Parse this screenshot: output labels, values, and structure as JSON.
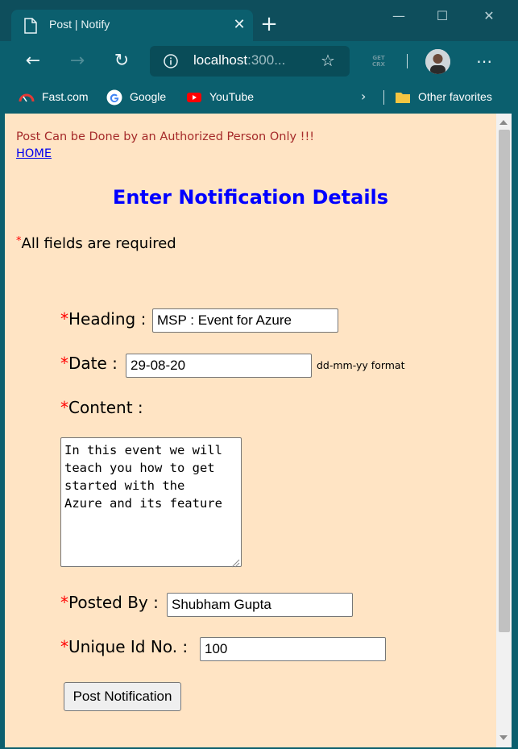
{
  "browser": {
    "tab_title": "Post | Notify",
    "url_host": "localhost",
    "url_rest": ":300...",
    "crx_label": "GET CRX",
    "favorites": [
      {
        "label": "Fast.com",
        "icon": "gauge-icon"
      },
      {
        "label": "Google",
        "icon": "google-icon"
      },
      {
        "label": "YouTube",
        "icon": "youtube-icon"
      }
    ],
    "other_favorites": "Other favorites"
  },
  "page": {
    "notice": "Post Can be Done by an Authorized Person Only !!!",
    "home_link": "HOME",
    "title": "Enter Notification Details",
    "required_star": "*",
    "required_note": "All fields are required"
  },
  "form": {
    "heading_label": "Heading :",
    "heading_value": "MSP : Event for Azure",
    "date_label": "Date :",
    "date_value": "29-08-20",
    "date_hint": "dd-mm-yy format",
    "content_label": "Content :",
    "content_value": "In this event we will\nteach you how to get\nstarted with the\nAzure and its feature",
    "posted_by_label": "Posted By :",
    "posted_by_value": "Shubham Gupta",
    "unique_id_label": "Unique Id No. :",
    "unique_id_value": "100",
    "submit_label": "Post Notification"
  },
  "colors": {
    "page_background": "#ffe4c4",
    "title_blue": "#0000ff",
    "notice_brown": "#a52a2a",
    "required_red": "#ff0000",
    "browser_teal": "#0b5f6e"
  }
}
